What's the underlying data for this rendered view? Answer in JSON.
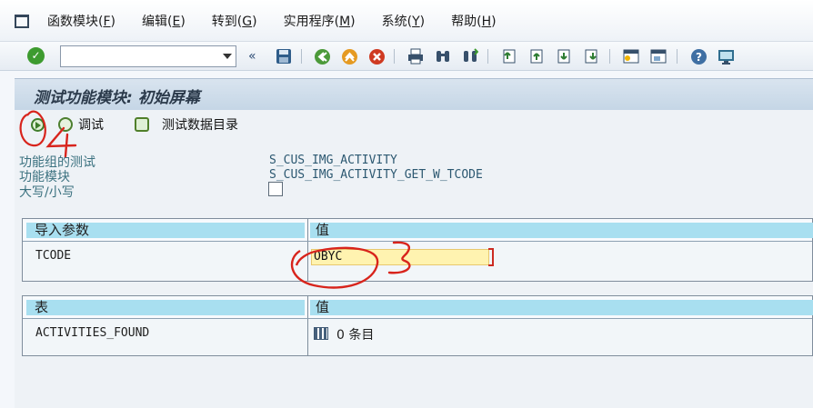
{
  "menu": [
    {
      "label": "函数模块(",
      "hotkey": "F",
      "end": ")"
    },
    {
      "label": "编辑(",
      "hotkey": "E",
      "end": ")"
    },
    {
      "label": "转到(",
      "hotkey": "G",
      "end": ")"
    },
    {
      "label": "实用程序(",
      "hotkey": "M",
      "end": ")"
    },
    {
      "label": "系统(",
      "hotkey": "Y",
      "end": ")"
    },
    {
      "label": "帮助(",
      "hotkey": "H",
      "end": ")"
    }
  ],
  "toolbar": {
    "back_chevrons": "«"
  },
  "title": "测试功能模块:  初始屏幕",
  "app_toolbar": {
    "debug_label": "调试",
    "testdata_label": "测试数据目录"
  },
  "info": {
    "group_label": "功能组的测试",
    "group_value": "S_CUS_IMG_ACTIVITY",
    "module_label": "功能模块",
    "module_value": "S_CUS_IMG_ACTIVITY_GET_W_TCODE",
    "case_label": "大写/小写"
  },
  "import_table": {
    "col1": "导入参数",
    "col2": "值",
    "row_name": "TCODE",
    "row_value": "OBYC"
  },
  "tables_table": {
    "col1": "表",
    "col2": "值",
    "row_name": "ACTIVITIES_FOUND",
    "row_count": "0",
    "row_unit": "条目"
  },
  "annotations": {
    "step4": "4",
    "step3": "3"
  },
  "colors": {
    "annotation_red": "#d8241c",
    "header_blue": "#a8dff0",
    "input_yellow": "#fff3b0"
  }
}
